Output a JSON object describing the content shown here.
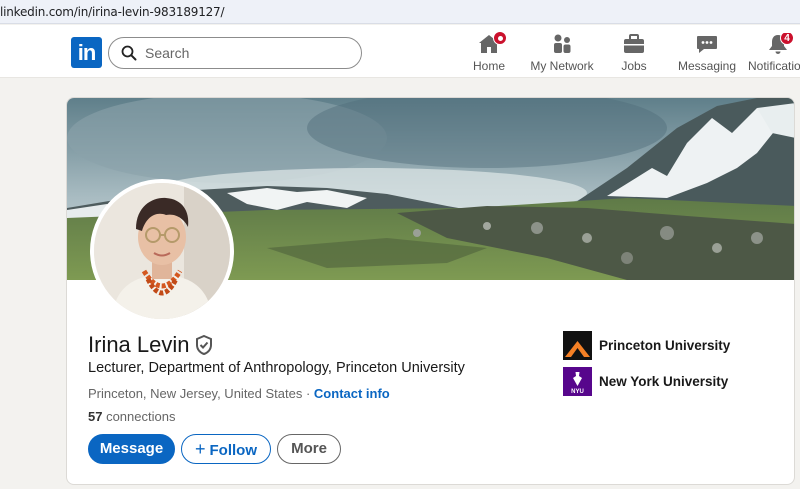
{
  "browser": {
    "url": "linkedin.com/in/irina-levin-983189127/"
  },
  "nav": {
    "logo": "in",
    "search_placeholder": "Search",
    "items": [
      {
        "label": "Home",
        "icon": "home-icon",
        "badge": ""
      },
      {
        "label": "My Network",
        "icon": "network-icon",
        "badge": ""
      },
      {
        "label": "Jobs",
        "icon": "briefcase-icon",
        "badge": ""
      },
      {
        "label": "Messaging",
        "icon": "chat-icon",
        "badge": ""
      },
      {
        "label": "Notifications",
        "icon": "bell-icon",
        "badge": "4"
      }
    ]
  },
  "profile": {
    "name": "Irina Levin",
    "headline": "Lecturer, Department of Anthropology, Princeton University",
    "location": "Princeton, New Jersey, United States",
    "separator": " · ",
    "contact_info": "Contact info",
    "connections_count": "57",
    "connections_label": " connections",
    "buttons": {
      "message": "Message",
      "follow": "Follow",
      "more": "More"
    }
  },
  "organizations": [
    {
      "name": "Princeton University",
      "color": "#f58025"
    },
    {
      "name": "New York University",
      "color": "#57068c",
      "logo_text": "NYU"
    }
  ],
  "colors": {
    "brand": "#0a66c2",
    "badge": "#cb112d"
  }
}
